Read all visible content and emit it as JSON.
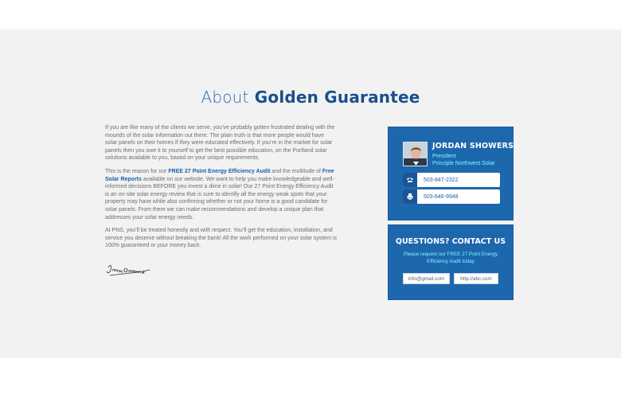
{
  "title": {
    "light": "About",
    "bold": "Golden Guarantee"
  },
  "intro": {
    "p1": "If you are like many of the clients we serve, you’ve probably gotten frustrated dealing with the mounds of the solar information out there. The plain truth is that more people would have solar panels on their homes if they were educated effectively. If you’re in the market for solar panels then you owe it to yourself to get the best possible education, on the Portland solar solutions available to you, based on your unique requirements.",
    "p2_before": "This is the reason for our ",
    "p2_link1": "FREE 27 Point Energy Efficiency Audit",
    "p2_mid": " and the multitude of ",
    "p2_link2": "Free Solar Reports",
    "p2_after": " available on our website. We want to help you make knowledgeable and well-informed decisions BEFORE you invest a dime in solar! Our 27 Point Energy Efficiency Audit is an on-site solar energy review that is sure to identify all the energy weak spots that your property may have while also confirming whether or not your home is a good candidate for solar panels. From there we can make recommendations and develop a unique plan that addresses your solar energy needs.",
    "p3": "At PNS, you’ll be treated honestly and with respect. You’ll get the education, installation, and service you deserve without breaking the bank! All the work performed on your solar system is 100% guaranteed or your money back."
  },
  "contact_card": {
    "name": "JORDAN SHOWERS",
    "role": "President",
    "company": "Principle Northwest Solar",
    "phone": "503-847-2322",
    "fax": "503-646-9948",
    "phone_icon": "phone-icon",
    "fax_icon": "fax-icon"
  },
  "questions": {
    "heading": "QUESTIONS? CONTACT US",
    "subtext": "Please request our FREE 27 Point Energy Efficiency Audit today",
    "email": "info@gmail.com",
    "url": "http://abc.com"
  },
  "colors": {
    "accent": "#1d67ad",
    "highlight": "#7ff6ff",
    "band_bg": "#f2f2f2",
    "text": "#6d6d6d"
  }
}
